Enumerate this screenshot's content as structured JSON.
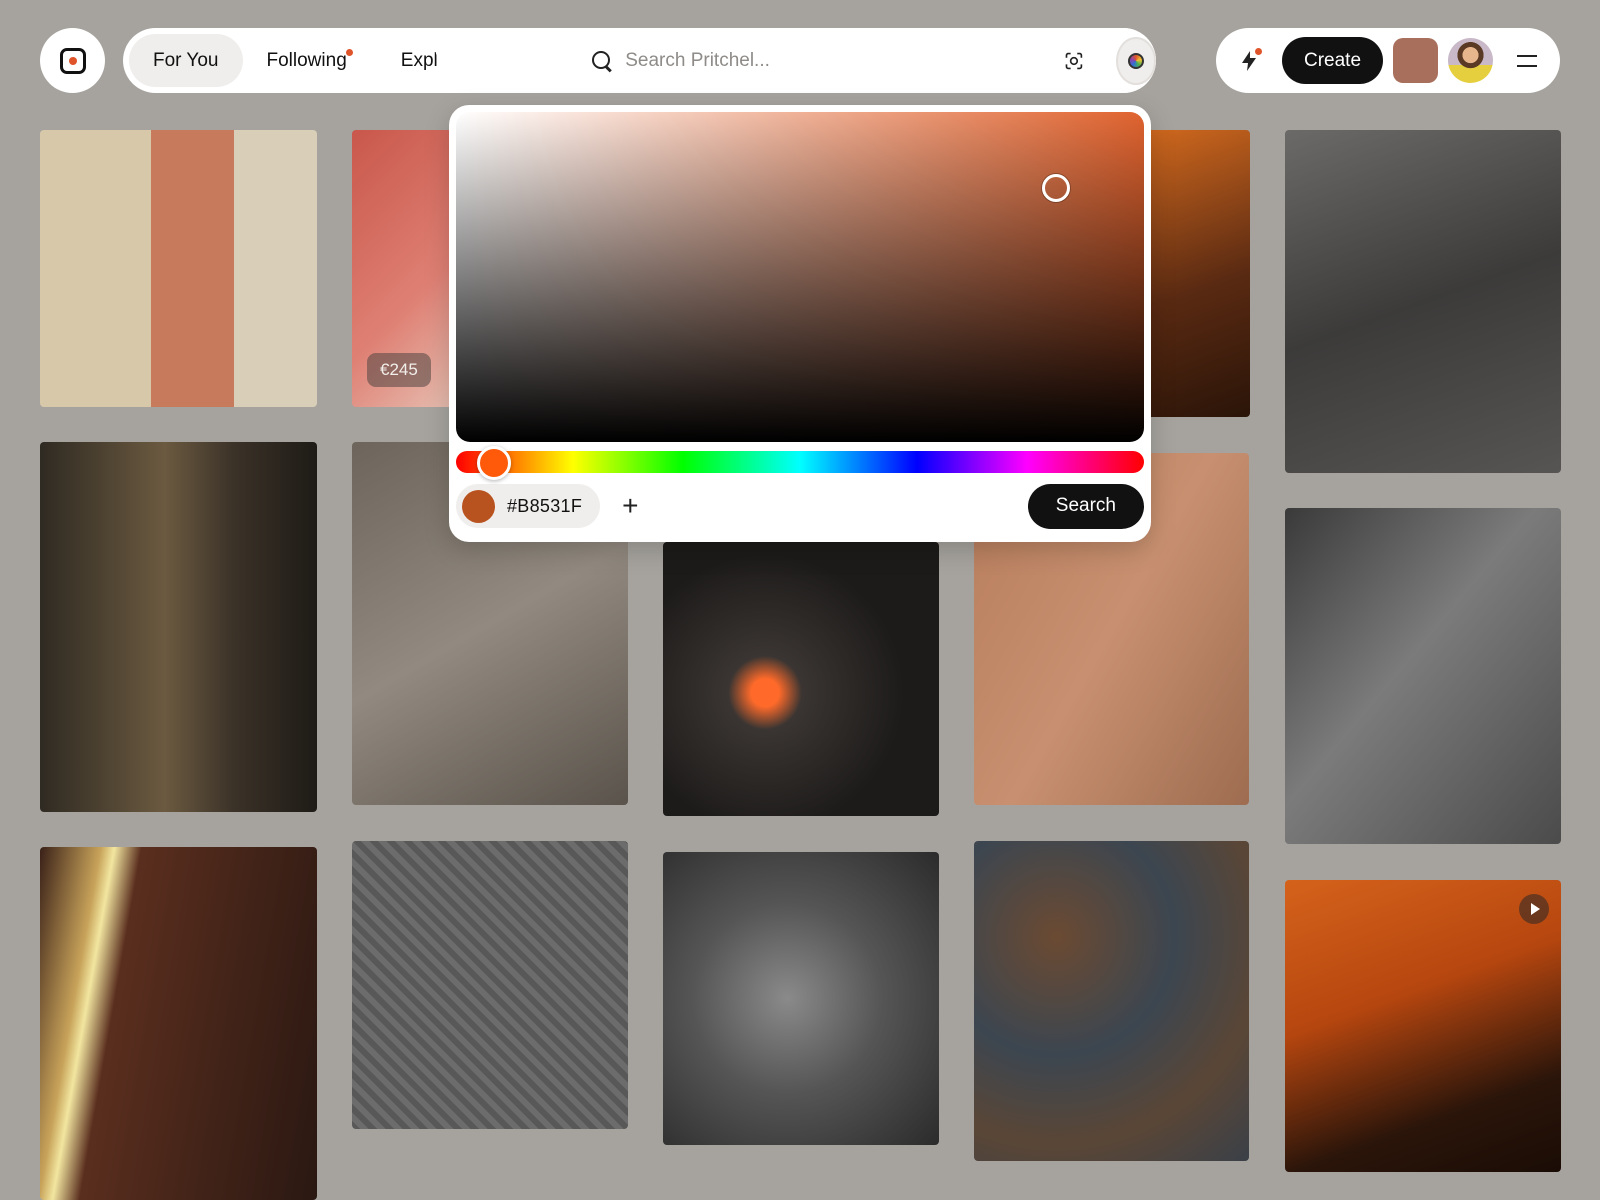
{
  "header": {
    "tabs": [
      {
        "label": "For You"
      },
      {
        "label": "Following"
      },
      {
        "label": "Explore"
      }
    ],
    "search": {
      "placeholder": "Search Pritchel..."
    },
    "create_label": "Create"
  },
  "grid": {
    "price_badge": "€245"
  },
  "color_picker": {
    "hex_value": "#B8531F",
    "add_label": "+",
    "search_label": "Search",
    "selected_color": "#B8531F"
  },
  "icons": {
    "logo": "logo-icon",
    "search": "search-icon",
    "lens": "visual-search-icon",
    "color": "color-picker-icon",
    "bolt": "bolt-icon",
    "menu": "menu-icon",
    "play": "play-icon"
  },
  "colors": {
    "accent": "#E0542A",
    "dark": "#111111",
    "overlay_bg": "#A6A39E"
  }
}
